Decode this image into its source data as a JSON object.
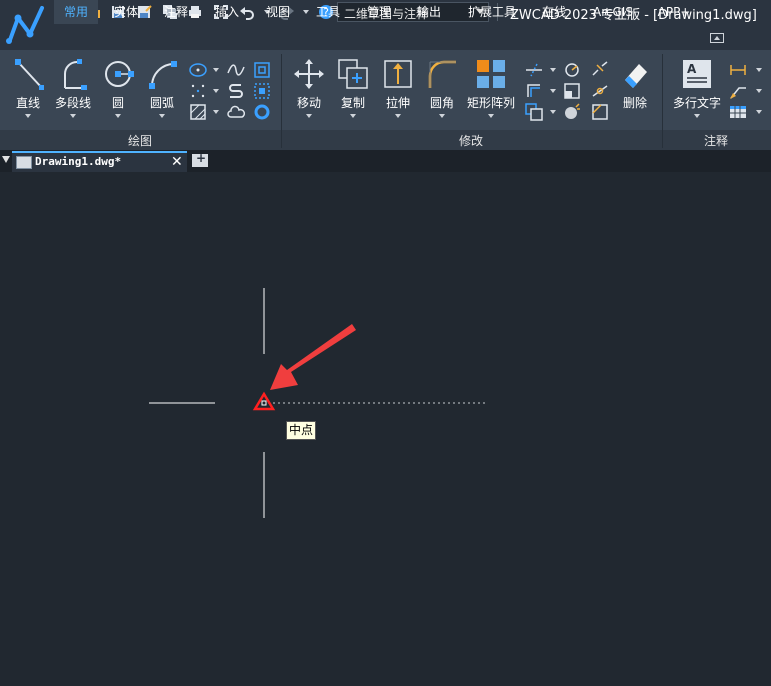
{
  "window": {
    "title": "ZWCAD 2023 专业版 - [Drawing1.dwg]"
  },
  "quick_access": {
    "workspace": "二维草图与注释",
    "icons": [
      "new-file-icon",
      "open-folder-icon",
      "save-icon",
      "save-as-icon",
      "plot-layers-icon",
      "print-icon",
      "full-screen-icon",
      "undo-icon",
      "redo-icon",
      "help-icon"
    ]
  },
  "tabs": [
    "常用",
    "实体",
    "注释",
    "插入",
    "视图",
    "工具",
    "管理",
    "输出",
    "扩展工具",
    "在线",
    "ArcGIS",
    "APP+"
  ],
  "active_tab": "常用",
  "ribbon": {
    "draw": {
      "label": "绘图",
      "line": "直线",
      "polyline": "多段线",
      "circle": "圆",
      "arc": "圆弧"
    },
    "modify": {
      "label": "修改",
      "move": "移动",
      "copy": "复制",
      "stretch": "拉伸",
      "fillet": "圆角",
      "array": "矩形阵列",
      "erase": "删除"
    },
    "annotation": {
      "label": "注释",
      "mtext": "多行文字"
    }
  },
  "document": {
    "tab_label": "Drawing1.dwg*"
  },
  "canvas": {
    "osnap_tooltip": "中点",
    "colors": {
      "marker": "#ff2020",
      "arrow": "#f03e3e",
      "background": "#212830"
    }
  }
}
